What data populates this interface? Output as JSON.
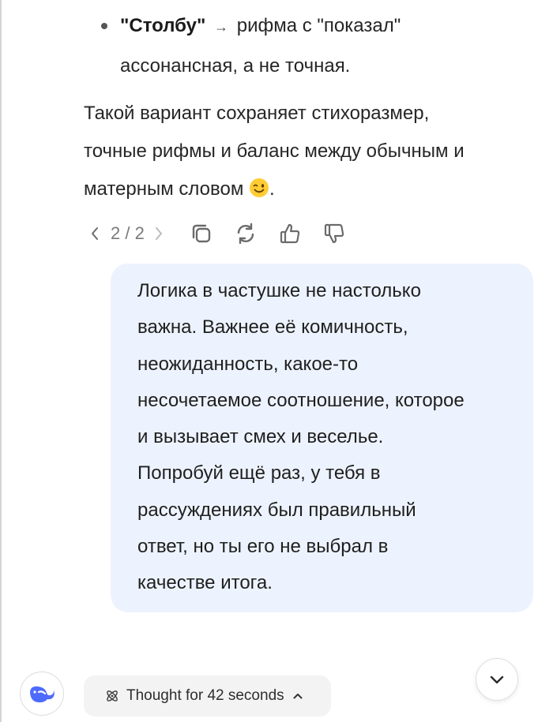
{
  "assistant_message": {
    "bullet": {
      "bold_word": "\"Столбу\"",
      "arrow": "→",
      "text_after_arrow": "рифма с \"показал\"",
      "continuation": "ассонансная, а не точная."
    },
    "paragraph_lines": [
      "Такой вариант сохраняет стихоразмер,",
      "точные рифмы и баланс между обычным и",
      "матерным словом"
    ],
    "paragraph_tail": ".",
    "emoji": "winking-face"
  },
  "actions": {
    "pagination": "2 / 2",
    "icons": [
      "copy-icon",
      "regenerate-icon",
      "thumbs-up-icon",
      "thumbs-down-icon"
    ]
  },
  "user_message": {
    "lines": [
      "Логика в частушке не настолько",
      "важна. Важнее её комичность,",
      "неожиданность, какое-то",
      "несочетаемое соотношение, которое",
      "и вызывает смех и веселье.",
      "Попробуй ещё раз, у тебя в",
      "рассуждениях был правильный",
      "ответ, но ты его не выбрал в",
      "качестве итога."
    ]
  },
  "bottom_bar": {
    "thought_label": "Thought for 42 seconds",
    "logo": "deepseek-whale-icon",
    "scroll_icon": "chevron-down-icon"
  },
  "colors": {
    "bubble_bg": "#edf3fe",
    "logo_blue": "#4d6bfe",
    "icon_gray": "#6b6b6b"
  }
}
